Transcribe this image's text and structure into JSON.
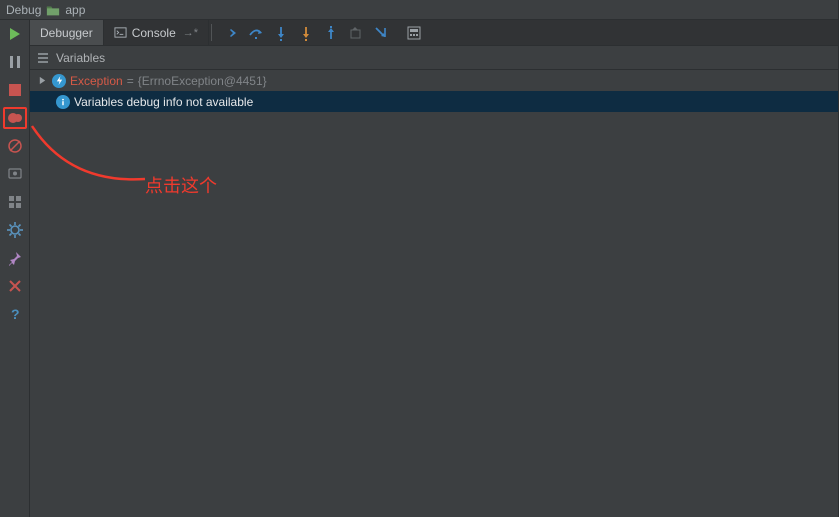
{
  "titlebar": {
    "label": "Debug",
    "app": "app"
  },
  "tabs": {
    "debugger": "Debugger",
    "console": "Console"
  },
  "vars": {
    "header": "Variables",
    "exception": {
      "name": "Exception",
      "eq": " = ",
      "value": "{ErrnoException@4451}"
    },
    "info": "Variables debug info not available"
  },
  "annotation": "点击这个",
  "icons": {
    "resume": "resume-icon",
    "pause": "pause-icon",
    "stop": "stop-icon",
    "breakpoints": "view-breakpoints-icon",
    "mute": "mute-breakpoints-icon",
    "dump": "thread-dump-icon",
    "layout": "restore-layout-icon",
    "settings": "settings-icon",
    "pin": "pin-icon",
    "close": "close-icon",
    "help": "help-icon",
    "console": "console-icon",
    "showexec": "show-exec-icon",
    "stepover": "step-over-icon",
    "stepinto": "step-into-icon",
    "forcestep": "force-step-into-icon",
    "stepout": "step-out-icon",
    "drop": "drop-frame-icon",
    "runcursor": "run-to-cursor-icon",
    "evaluate": "evaluate-icon",
    "varsicon": "variables-icon",
    "lightning": "lightning-icon",
    "infoicon": "info-icon"
  }
}
